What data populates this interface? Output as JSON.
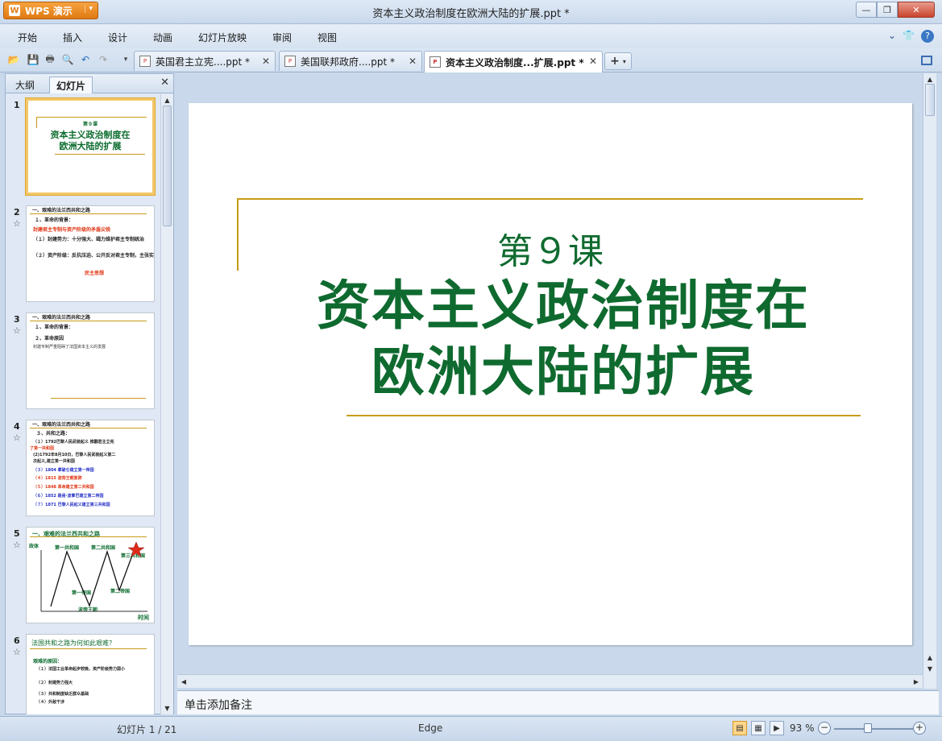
{
  "window": {
    "app_name": "WPS 演示",
    "app_logo": "W",
    "title": "资本主义政治制度在欧洲大陆的扩展.ppt *",
    "controls": {
      "minimize": "—",
      "maximize": "❐",
      "close": "✕"
    }
  },
  "menu": {
    "items": [
      "开始",
      "插入",
      "设计",
      "动画",
      "幻灯片放映",
      "审阅",
      "视图"
    ],
    "right_icons": [
      "chevron-down-icon",
      "skin-icon",
      "help-icon"
    ]
  },
  "tabs": [
    {
      "label": "英国君主立宪....ppt *",
      "active": false
    },
    {
      "label": "美国联邦政府....ppt *",
      "active": false
    },
    {
      "label": "资本主义政治制度...扩展.ppt *",
      "active": true
    }
  ],
  "left_pane": {
    "tab_outline": "大纲",
    "tab_slides": "幻灯片",
    "close": "✕",
    "thumbnails": [
      {
        "num": "1",
        "lines": [
          "第９课",
          "资本主义政治制度在",
          "欧洲大陆的扩展"
        ]
      },
      {
        "num": "2",
        "lines": [
          "一、艰难的法兰西共和之路",
          "１、革命的背景：",
          "封建君主专制与资产阶级的矛盾尖锐",
          "（１）封建势力：十分强大、竭力维护君主专制统治",
          "（２）资产阶级：反抗压迫、公开反对君主专制，主张实行共和",
          "民主思想"
        ]
      },
      {
        "num": "3",
        "lines": [
          "一、艰难的法兰西共和之路",
          "１、革命的背景：",
          "２、革命原因",
          "封建专制严重阻碍了法国资本主义的发展"
        ]
      },
      {
        "num": "4",
        "lines": [
          "一、艰难的法兰西共和之路",
          "３、共和之路：",
          "（１）1792巴黎人民武装起义 推翻君主立宪",
          "了第一共和国",
          "(2)1792年8月10日，巴黎人民武装起义第二",
          "次起义,建立第一共和国",
          "（３）1804  拿破仑建立第一帝国",
          "（４）1815  波旁王朝复辟",
          "（５）1848  革命建立第二共和国",
          "（６）1852  路易·波拿巴建立第二帝国",
          "（７）1871  巴黎人民起义建立第三共和国"
        ]
      },
      {
        "num": "5",
        "lines": [
          "一、艰难的法兰西共和之路",
          "政体",
          "第一共和国",
          "第二共和国",
          "第三共和国",
          "第一帝国",
          "第二帝国",
          "波旁王朝",
          "时间"
        ]
      },
      {
        "num": "6",
        "lines": [
          "法国共和之路为何如此艰难？",
          "艰难的原因：",
          "（１）法国工业革命起步较晚，资产阶级势力弱小",
          "（２）封建势力强大",
          "（３）共和制度缺乏群众基础",
          "（４）外敌干涉"
        ]
      }
    ]
  },
  "slide": {
    "lesson": "第９课",
    "title_line1": "资本主义政治制度在",
    "title_line2": "欧洲大陆的扩展"
  },
  "notes_placeholder": "单击添加备注",
  "status": {
    "slide_counter": "幻灯片 1 / 21",
    "theme": "Edge",
    "zoom": "93 %"
  },
  "colors": {
    "slide_green": "#0f6a2f",
    "gold_rule": "#c69c14",
    "accent_orange": "#e07a12"
  }
}
